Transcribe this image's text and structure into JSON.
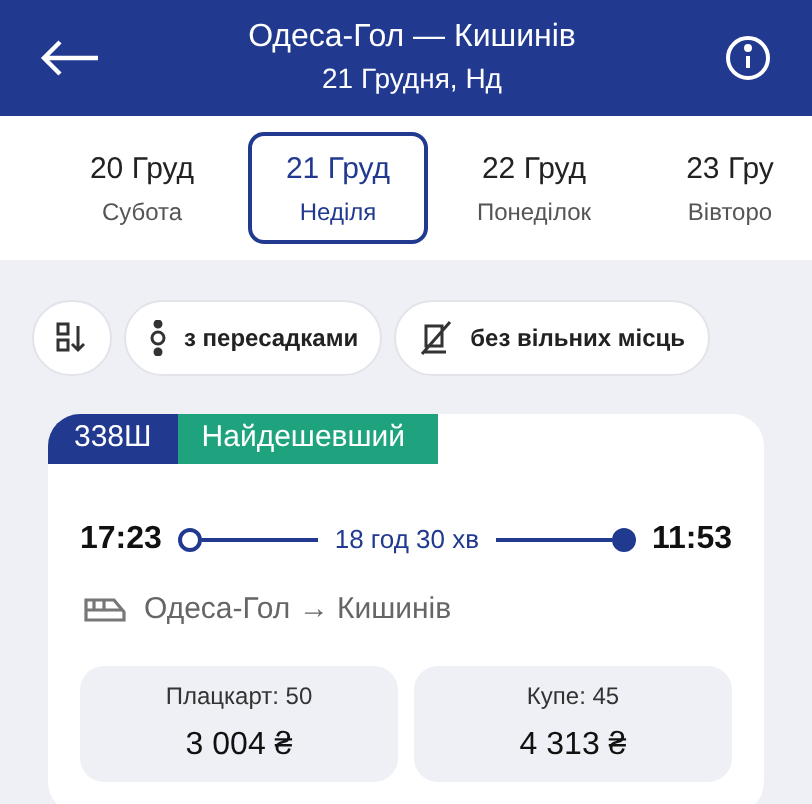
{
  "header": {
    "title": "Одеса-Гол — Кишинів",
    "subtitle": "21 Грудня, Нд"
  },
  "dates": [
    {
      "date": "20 Груд",
      "weekday": "Субота",
      "selected": false
    },
    {
      "date": "21 Груд",
      "weekday": "Неділя",
      "selected": true
    },
    {
      "date": "22 Груд",
      "weekday": "Понеділок",
      "selected": false
    },
    {
      "date": "23 Гру",
      "weekday": "Вівторо",
      "selected": false
    }
  ],
  "filters": [
    {
      "kind": "sort"
    },
    {
      "kind": "transfers",
      "label": "з пересадками"
    },
    {
      "kind": "no_seats",
      "label": "без вільних місць"
    }
  ],
  "train": {
    "number": "338Ш",
    "badge": "Найдешевший",
    "departure": "17:23",
    "duration": "18 год 30 хв",
    "arrival": "11:53",
    "route": "Одеса-Гол → Кишинів",
    "classes": [
      {
        "label": "Плацкарт: 50",
        "price": "3 004 ₴"
      },
      {
        "label": "Купе: 45",
        "price": "4 313 ₴"
      }
    ]
  }
}
